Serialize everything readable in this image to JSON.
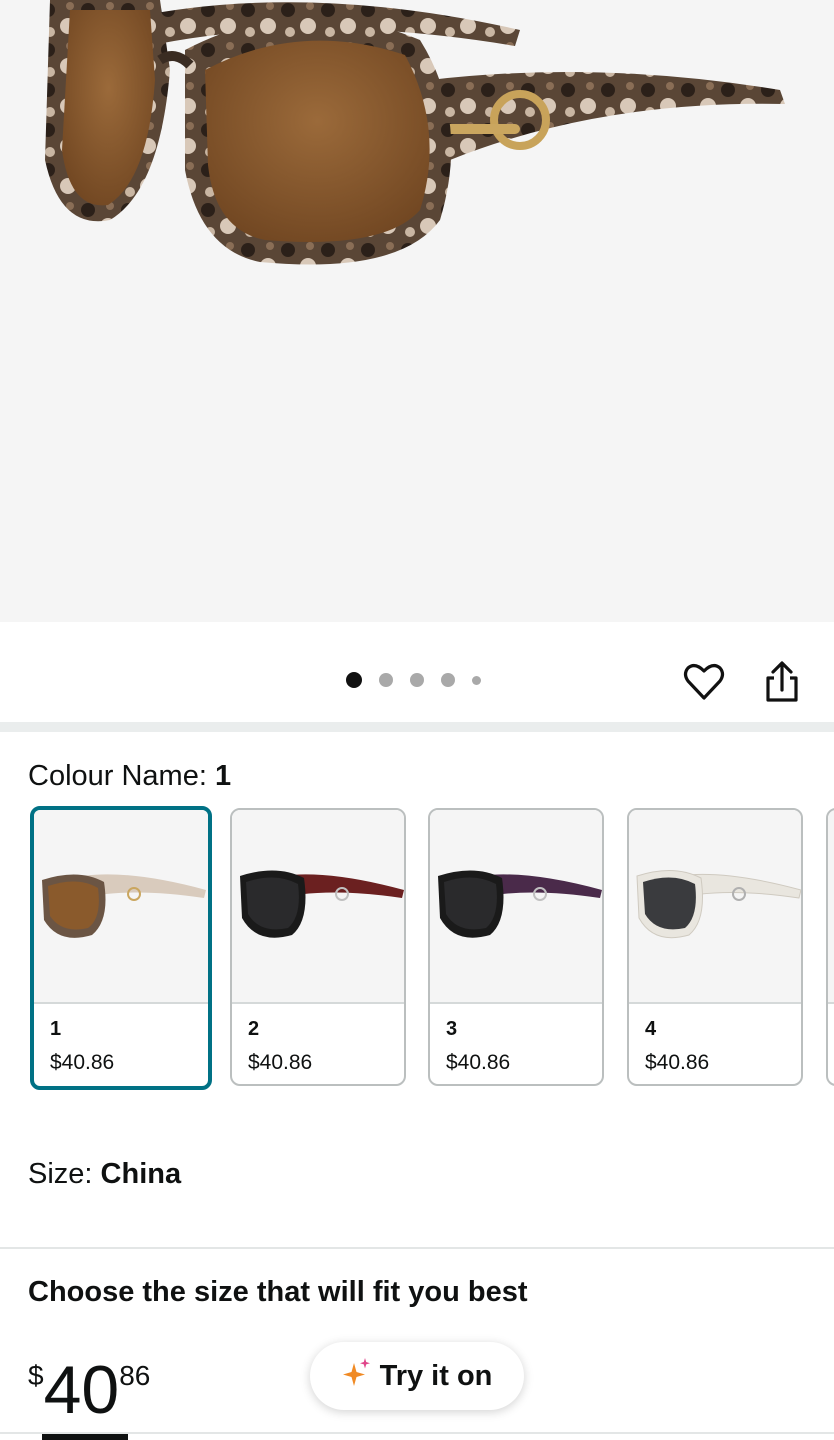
{
  "hero": {
    "image_alt": "tortoiseshell oversized sunglasses with brown lenses"
  },
  "pager": {
    "count": 5,
    "active_index": 0
  },
  "actions": {
    "wishlist_icon": "heart-icon",
    "share_icon": "share-icon"
  },
  "colour": {
    "label": "Colour Name:",
    "selected": "1",
    "options": [
      {
        "num": "1",
        "price": "$40.86",
        "frame": "#6b5544",
        "lens": "#8a5a2c",
        "arm": "#d9cbbd"
      },
      {
        "num": "2",
        "price": "$40.86",
        "frame": "#1a1a1a",
        "lens": "#2a2a2c",
        "arm": "#6b2020"
      },
      {
        "num": "3",
        "price": "$40.86",
        "frame": "#1a1a1a",
        "lens": "#2a2a2c",
        "arm": "#4a2a4a"
      },
      {
        "num": "4",
        "price": "$40.86",
        "frame": "#e9e6df",
        "lens": "#3a3b3e",
        "arm": "#e9e6df"
      }
    ]
  },
  "size": {
    "label": "Size:",
    "value": "China"
  },
  "fit": {
    "title": "Choose the size that will fit you best"
  },
  "price": {
    "symbol": "$",
    "whole": "40",
    "fraction": "86"
  },
  "tryon": {
    "label": "Try it on",
    "icon": "sparkle-icon"
  },
  "colors": {
    "accent": "#007185"
  }
}
